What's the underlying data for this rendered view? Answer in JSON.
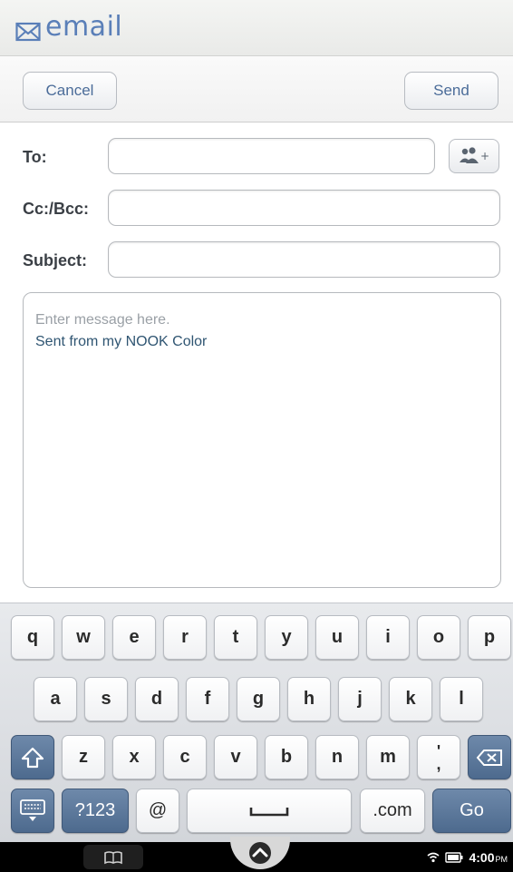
{
  "header": {
    "title": "email",
    "icon": "envelope-icon"
  },
  "actions": {
    "cancel_label": "Cancel",
    "send_label": "Send"
  },
  "form": {
    "to_label": "To:",
    "cc_label": "Cc:/Bcc:",
    "subject_label": "Subject:",
    "to_value": "",
    "cc_value": "",
    "subject_value": "",
    "contacts_icon": "add-contacts-icon"
  },
  "message": {
    "placeholder": "Enter message here.",
    "signature": "Sent from my NOOK Color"
  },
  "keyboard": {
    "row1": [
      "q",
      "w",
      "e",
      "r",
      "t",
      "y",
      "u",
      "i",
      "o",
      "p"
    ],
    "row2": [
      "a",
      "s",
      "d",
      "f",
      "g",
      "h",
      "j",
      "k",
      "l"
    ],
    "row3": [
      "z",
      "x",
      "c",
      "v",
      "b",
      "n",
      "m"
    ],
    "punct_key": "' ,",
    "symbols_label": "?123",
    "at_label": "@",
    "dotcom_label": ".com",
    "go_label": "Go"
  },
  "status": {
    "time": "4:00",
    "ampm": "PM"
  },
  "colors": {
    "accent": "#5a7fb8",
    "key_dark": "#5c789c",
    "bar": "#000000"
  }
}
